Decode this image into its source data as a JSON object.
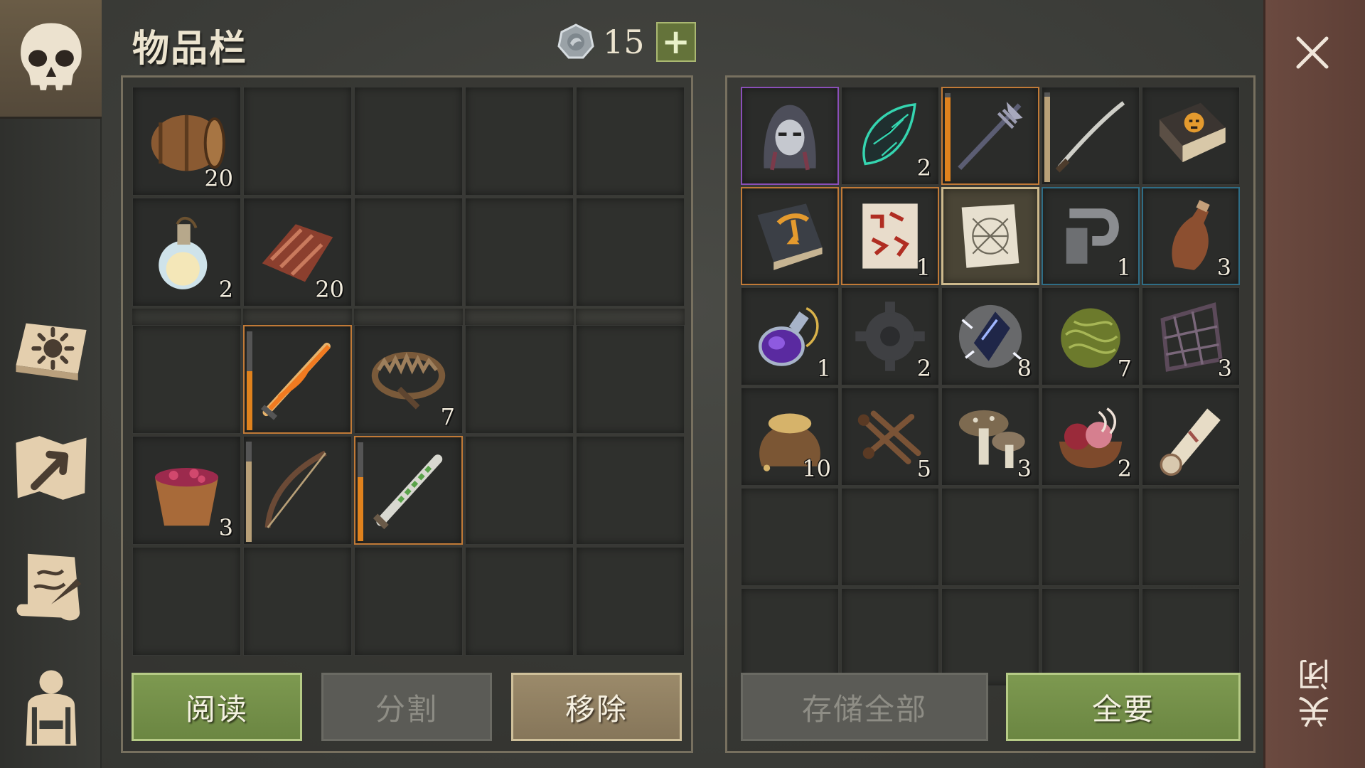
{
  "title": "物品栏",
  "currency": {
    "amount": "15",
    "plus_label": "+"
  },
  "sidebar": {
    "items": [
      {
        "name": "character-skull",
        "icon": "skull-icon",
        "active": true
      },
      {
        "name": "crafting-book",
        "icon": "sun-book-icon",
        "active": false
      },
      {
        "name": "map",
        "icon": "map-icon",
        "active": false
      },
      {
        "name": "quests-scroll",
        "icon": "quill-scroll-icon",
        "active": false
      },
      {
        "name": "equipment",
        "icon": "character-silhouette-icon",
        "active": false
      }
    ]
  },
  "inventory": {
    "backpack": [
      {
        "icon": "barrel-icon",
        "count": "20"
      },
      null,
      null,
      null,
      null,
      {
        "icon": "potion-flask-icon",
        "count": "2"
      },
      {
        "icon": "raw-meat-icon",
        "count": "20"
      },
      null,
      null,
      null
    ],
    "belt": [
      null,
      {
        "icon": "flame-sword-icon",
        "count": "",
        "border": "orange",
        "durability": 0.6
      },
      {
        "icon": "bear-trap-icon",
        "count": "7"
      },
      null,
      null,
      {
        "icon": "berry-bucket-icon",
        "count": "3"
      },
      {
        "icon": "bow-icon",
        "count": "",
        "durability": 0.8,
        "dur_color": "tan"
      },
      {
        "icon": "poison-dagger-icon",
        "count": "",
        "border": "orange",
        "durability": 0.65
      },
      null,
      null,
      null,
      null,
      null,
      null,
      null
    ]
  },
  "storage": {
    "slots": [
      {
        "icon": "hooded-figure-icon",
        "count": "",
        "border": "purple"
      },
      {
        "icon": "cursed-stone-icon",
        "count": "2"
      },
      {
        "icon": "spiked-spear-icon",
        "count": "",
        "border": "orange",
        "durability": 0.95
      },
      {
        "icon": "katana-icon",
        "count": "",
        "durability": 0.95,
        "dur_color": "tan"
      },
      {
        "icon": "mask-book-icon",
        "count": ""
      },
      {
        "icon": "pickaxe-book-icon",
        "count": "",
        "border": "orange"
      },
      {
        "icon": "red-glyph-scroll-icon",
        "count": "1",
        "border": "orange"
      },
      {
        "icon": "blueprint-scroll-icon",
        "count": "",
        "border": "cream",
        "selected": true
      },
      {
        "icon": "metal-clamp-icon",
        "count": "1",
        "border": "blue"
      },
      {
        "icon": "bottle-icon",
        "count": "3",
        "border": "blue"
      },
      {
        "icon": "purple-potion-icon",
        "count": "1"
      },
      {
        "icon": "gear-icon",
        "count": "2"
      },
      {
        "icon": "lightning-crystal-icon",
        "count": "8"
      },
      {
        "icon": "fiber-ball-icon",
        "count": "7"
      },
      {
        "icon": "rope-net-icon",
        "count": "3"
      },
      {
        "icon": "grain-sack-icon",
        "count": "10"
      },
      {
        "icon": "nails-icon",
        "count": "5"
      },
      {
        "icon": "mushrooms-icon",
        "count": "3"
      },
      {
        "icon": "entrails-bowl-icon",
        "count": "2"
      },
      {
        "icon": "rolled-scroll-icon",
        "count": ""
      },
      null,
      null,
      null,
      null,
      null,
      null,
      null,
      null,
      null,
      null
    ]
  },
  "buttons": {
    "read": "阅读",
    "split": "分割",
    "remove": "移除",
    "store_all": "存储全部",
    "take_all": "全要"
  },
  "close_label": "关闭",
  "colors": {
    "accent_green": "#7d9950",
    "accent_orange": "#e0821d",
    "rare_purple": "#8a4fb8",
    "rare_blue": "#2f6d86",
    "close_bar": "#6b4a40"
  }
}
